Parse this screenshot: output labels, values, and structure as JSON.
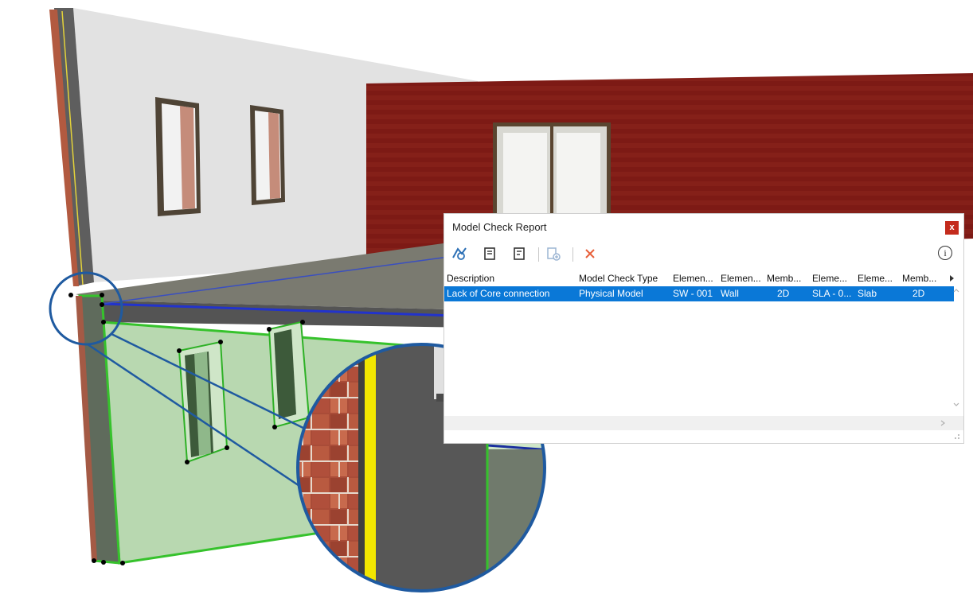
{
  "dialog": {
    "title": "Model Check Report",
    "close_label": "x",
    "info_label": "i",
    "toolbar_icons": [
      "zoom-to-element-icon",
      "select-element-icon",
      "select-other-element-icon",
      "add-issue-icon",
      "delete-icon"
    ],
    "columns": [
      "Description",
      "Model Check Type",
      "Elemen...",
      "Elemen...",
      "Memb...",
      "Eleme...",
      "Eleme...",
      "Memb..."
    ],
    "rows": [
      [
        "Lack of Core connection",
        "Physical Model",
        "SW - 001",
        "Wall",
        "2D",
        "SLA - 0...",
        "Slab",
        "2D"
      ]
    ],
    "selected_row": 0,
    "colors": {
      "selection": "#0a78d7",
      "close": "#c42b1c",
      "delete": "#e8613c"
    }
  },
  "scene": {
    "wall_color": "#e2e2e2",
    "brick_color": "#7d1a15",
    "highlight_color": "#3bd12e",
    "slab_color": "#6d6d64",
    "zoom_ring_color": "#1f5aa0"
  }
}
